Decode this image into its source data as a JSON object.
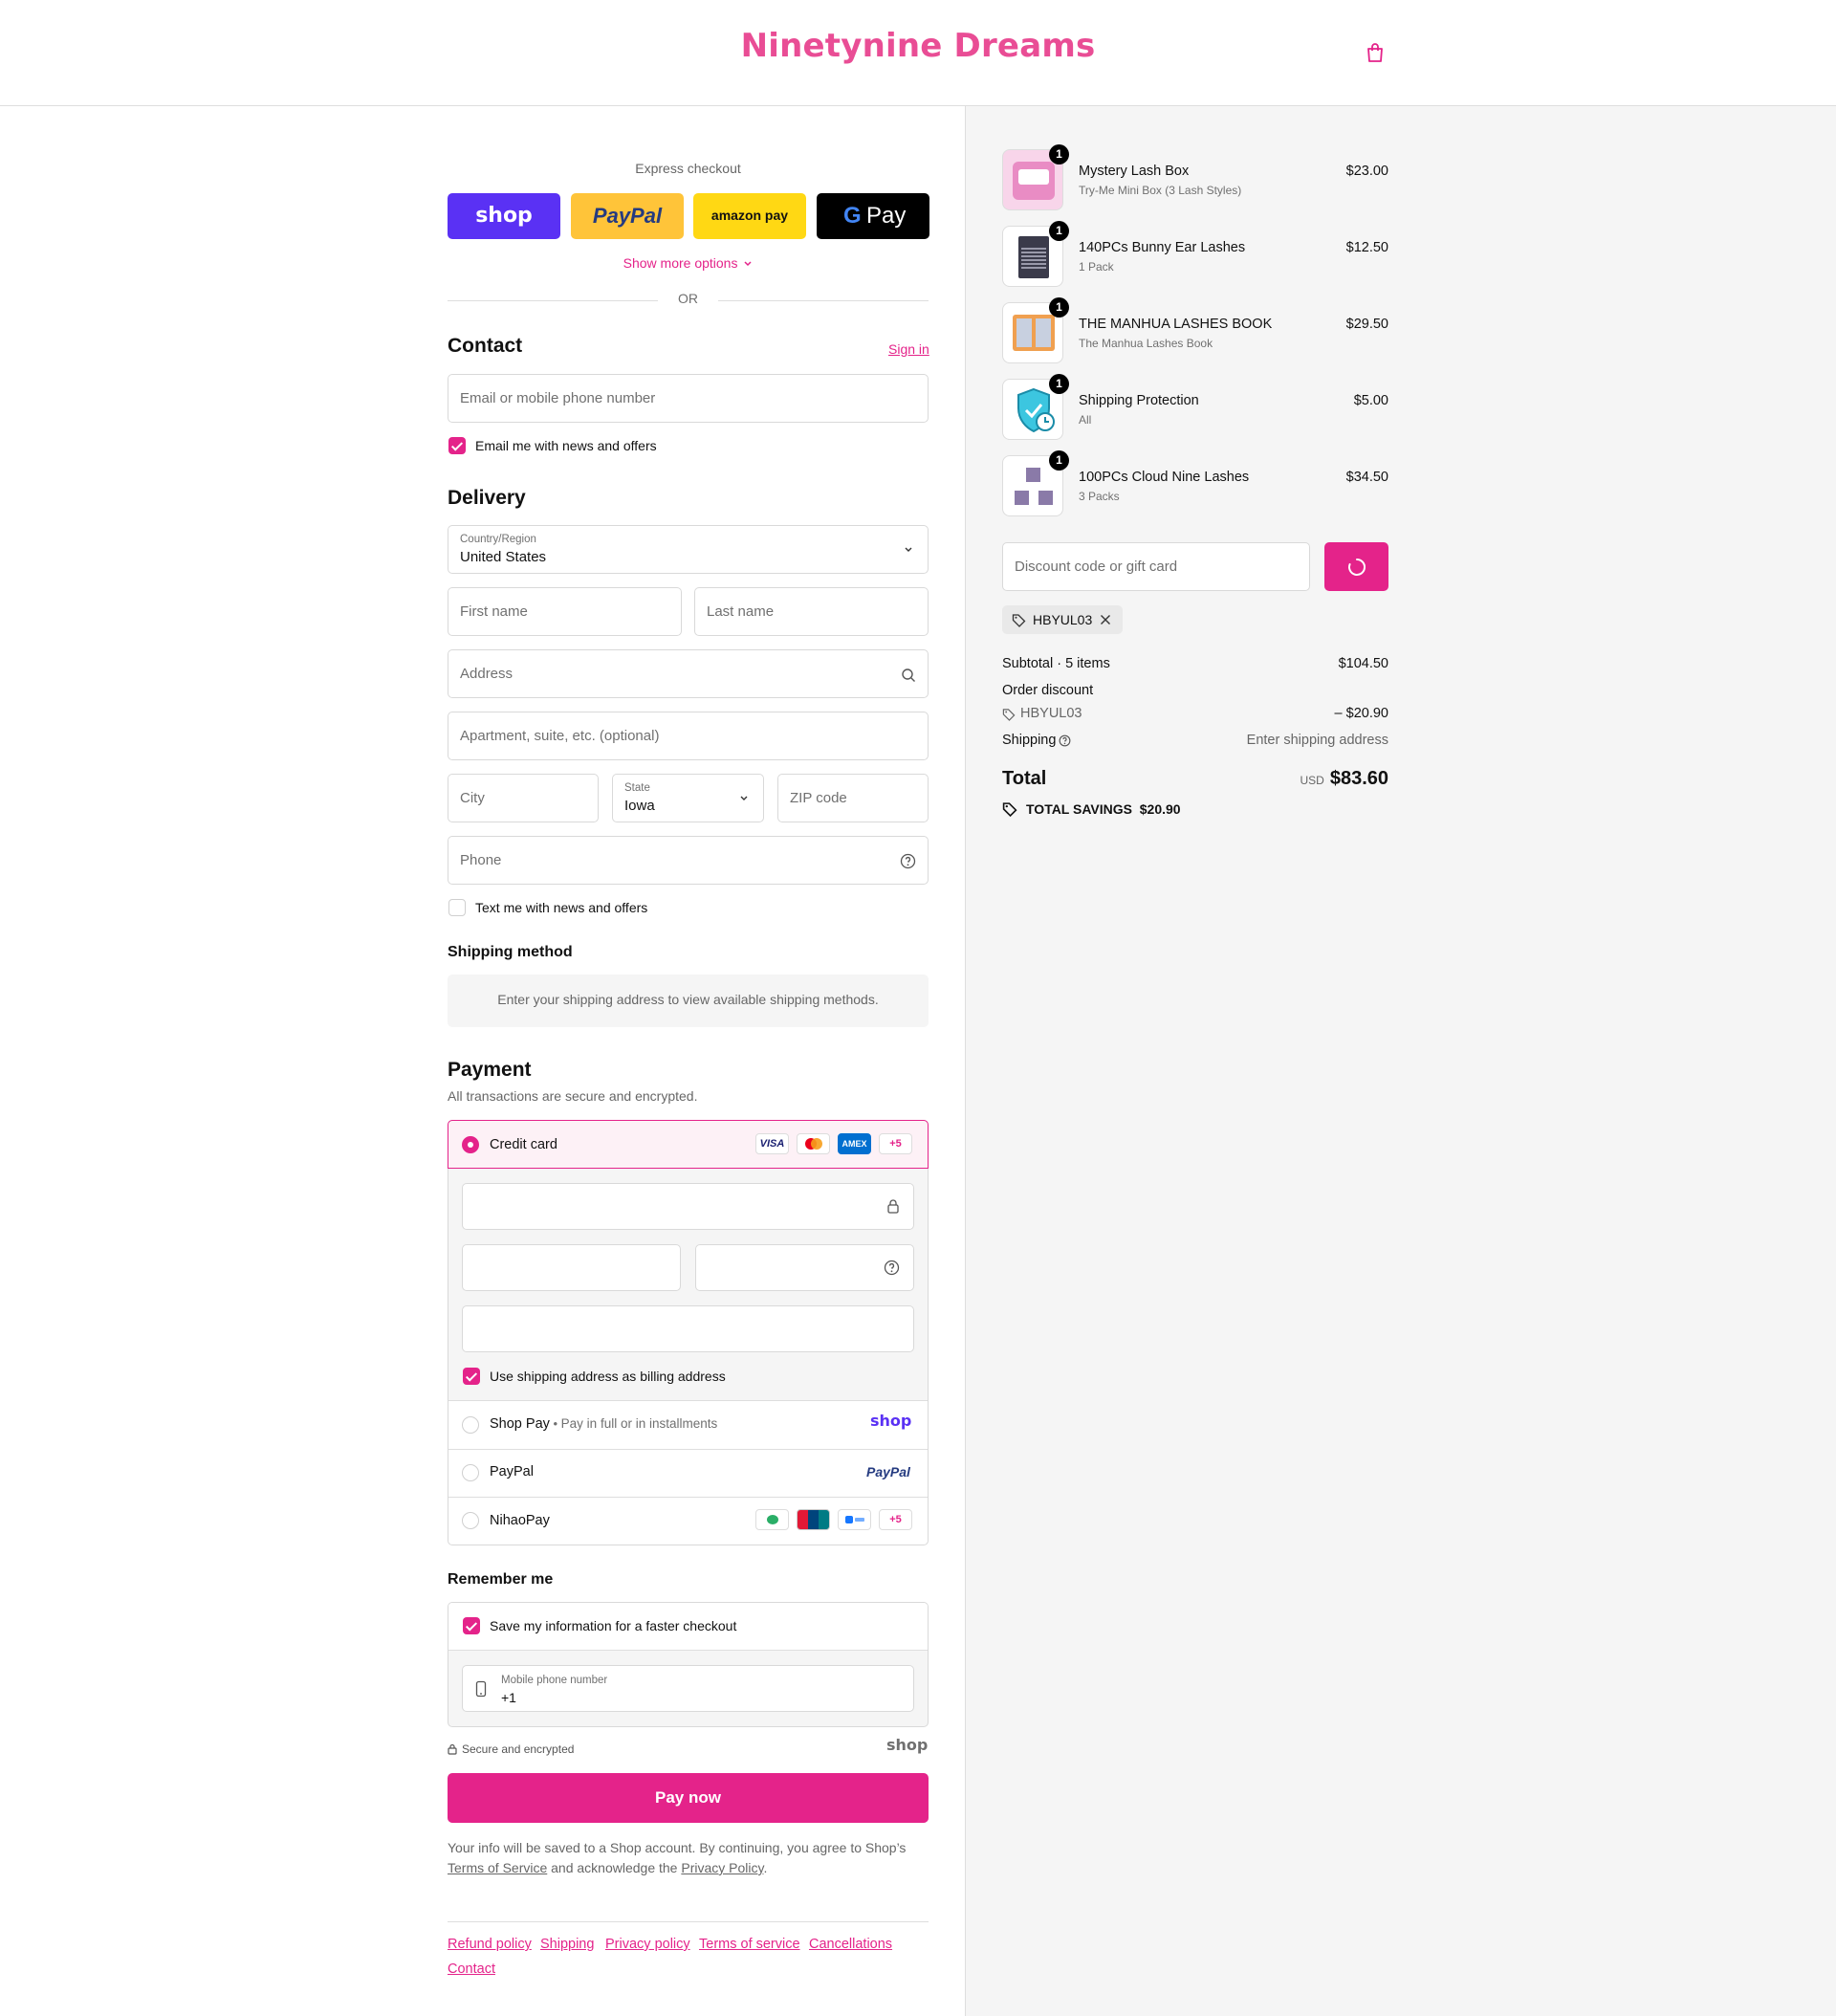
{
  "header": {
    "brand": "Ninetynine Dreams"
  },
  "express": {
    "title": "Express checkout",
    "buttons": [
      {
        "label": "shop",
        "color": "#5a31f4"
      },
      {
        "label": "PayPal",
        "color": "#ffc439"
      },
      {
        "label": "amazon pay",
        "color": "#ffd814"
      },
      {
        "label": "Pay",
        "color": "#000000"
      }
    ],
    "more_options": "Show more options",
    "or": "OR"
  },
  "contact": {
    "heading": "Contact",
    "sign_in": "Sign in",
    "email_placeholder": "Email or mobile phone number",
    "news_label": "Email me with news and offers"
  },
  "delivery": {
    "heading": "Delivery",
    "country_label": "Country/Region",
    "country_value": "United States",
    "first_name": "First name",
    "last_name": "Last name",
    "address": "Address",
    "apartment": "Apartment, suite, etc. (optional)",
    "city": "City",
    "state_label": "State",
    "state_value": "Iowa",
    "zip": "ZIP code",
    "phone": "Phone",
    "text_label": "Text me with news and offers"
  },
  "shipping_method": {
    "heading": "Shipping method",
    "notice": "Enter your shipping address to view available shipping methods."
  },
  "payment": {
    "heading": "Payment",
    "subtitle": "All transactions are secure and encrypted.",
    "credit_card": "Credit card",
    "card_badges": [
      "VISA",
      "",
      "AMEX",
      "+5"
    ],
    "billing_label": "Use shipping address as billing address",
    "shop_pay": "Shop Pay",
    "shop_pay_sub": "Pay in full or in installments",
    "shop_logo": "shop",
    "paypal": "PayPal",
    "paypal_logo": "PayPal",
    "nihaopay": "NihaoPay",
    "nihao_more": "+5"
  },
  "remember": {
    "heading": "Remember me",
    "save_label": "Save my information for a faster checkout",
    "mobile_label": "Mobile phone number",
    "mobile_value": "+1",
    "secure": "Secure and encrypted",
    "shop_logo": "shop"
  },
  "pay_now": "Pay now",
  "legal": {
    "line1": "Your info will be saved to a Shop account. By continuing, you agree to Shop’s",
    "tos": "Terms of Service",
    "mid": "and acknowledge the",
    "privacy": "Privacy Policy",
    "end": "."
  },
  "footer_links": [
    "Refund policy",
    "Shipping",
    "Privacy policy",
    "Terms of service",
    "Cancellations",
    "Contact"
  ],
  "order": {
    "items": [
      {
        "name": "Mystery Lash Box",
        "variant": "Try-Me Mini Box (3 Lash Styles)",
        "price": "$23.00",
        "qty": "1"
      },
      {
        "name": "140PCs Bunny Ear Lashes",
        "variant": "1 Pack",
        "price": "$12.50",
        "qty": "1"
      },
      {
        "name": "THE MANHUA LASHES BOOK",
        "variant": "The Manhua Lashes Book",
        "price": "$29.50",
        "qty": "1"
      },
      {
        "name": "Shipping Protection",
        "variant": "All",
        "price": "$5.00",
        "qty": "1"
      },
      {
        "name": "100PCs Cloud Nine Lashes",
        "variant": "3 Packs",
        "price": "$34.50",
        "qty": "1"
      }
    ],
    "discount_placeholder": "Discount code or gift card",
    "applied_code": "HBYUL03",
    "subtotal_label": "Subtotal · 5 items",
    "subtotal": "$104.50",
    "order_discount_label": "Order discount",
    "discount_code": "HBYUL03",
    "discount_amount": "– $20.90",
    "shipping_label": "Shipping",
    "shipping_value": "Enter shipping address",
    "total_label": "Total",
    "currency": "USD",
    "total": "$83.60",
    "savings_label": "TOTAL SAVINGS",
    "savings": "$20.90"
  },
  "colors": {
    "accent": "#e4238a",
    "brand": "#e94d95"
  }
}
